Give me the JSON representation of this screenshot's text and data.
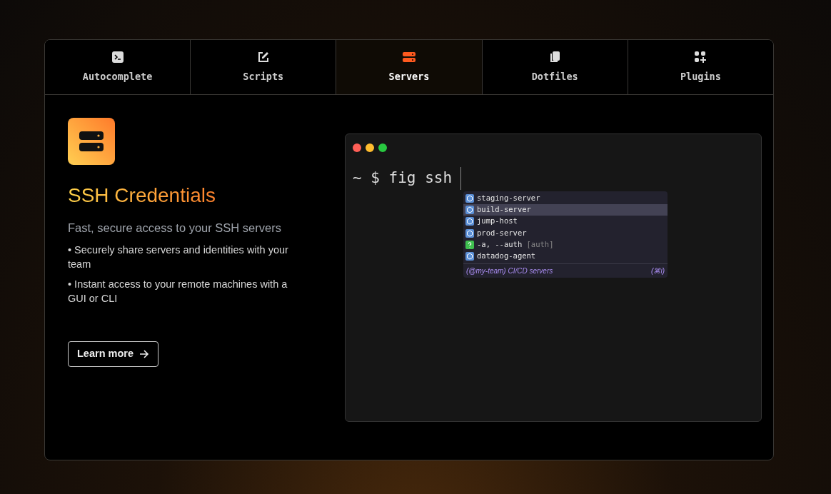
{
  "tabs": [
    {
      "label": "Autocomplete",
      "kind": "terminal",
      "selected": false
    },
    {
      "label": "Scripts",
      "kind": "edit",
      "selected": false
    },
    {
      "label": "Servers",
      "kind": "server",
      "selected": true
    },
    {
      "label": "Dotfiles",
      "kind": "files",
      "selected": false
    },
    {
      "label": "Plugins",
      "kind": "plugins",
      "selected": false
    }
  ],
  "feature": {
    "title": "SSH Credentials",
    "subtitle": "Fast, secure access to your SSH servers",
    "bullets": [
      "• Securely share servers and identities with your team",
      "• Instant access to your remote machines with a GUI or CLI"
    ],
    "button": "Learn more"
  },
  "terminal": {
    "prompt": "~ $ fig ssh",
    "suggestions": [
      {
        "kind": "server",
        "label": "staging-server",
        "selected": false
      },
      {
        "kind": "server",
        "label": "build-server",
        "selected": true
      },
      {
        "kind": "server",
        "label": "jump-host",
        "selected": false
      },
      {
        "kind": "server",
        "label": "prod-server",
        "selected": false
      },
      {
        "kind": "option",
        "label": "-a, --auth",
        "hint": "[auth]",
        "selected": false
      },
      {
        "kind": "server",
        "label": "datadog-agent",
        "selected": false
      }
    ],
    "footer": {
      "description": "(@my-team) CI/CD servers",
      "shortcut": "(⌘i)"
    }
  }
}
